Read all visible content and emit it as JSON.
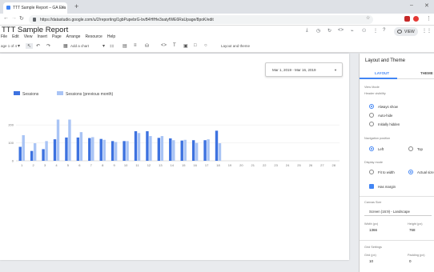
{
  "browser": {
    "tab_title": "TTT Sample Report – GA Exa",
    "url": "https://datastudio.google.com/u/2/reporting/1gbPupebrG-bvB4HfHe3satyfWE6RaUpage/8poK/edit"
  },
  "report": {
    "title": "TTT Sample Report",
    "menu": [
      "File",
      "Edit",
      "View",
      "Insert",
      "Page",
      "Arrange",
      "Resource",
      "Help"
    ],
    "page_indicator": "age 1 of 4",
    "add_chart": "Add a chart",
    "layout_theme": "Layout and theme",
    "view_label": "VIEW"
  },
  "date_range": "Mar 1, 2019 - Mar 16, 2019",
  "chart_data": {
    "type": "bar",
    "categories": [
      "1",
      "2",
      "3",
      "4",
      "5",
      "6",
      "7",
      "8",
      "9",
      "10",
      "11",
      "12",
      "13",
      "14",
      "15",
      "16",
      "17",
      "18",
      "19",
      "20",
      "21",
      "22",
      "23",
      "24",
      "25",
      "26",
      "27",
      "28"
    ],
    "series": [
      {
        "name": "Sessions",
        "color": "#3d72e0",
        "values": [
          78,
          55,
          65,
          120,
          130,
          130,
          127,
          122,
          110,
          110,
          165,
          165,
          128,
          125,
          113,
          115,
          115,
          168,
          null,
          null,
          null,
          null,
          null,
          null,
          null,
          null,
          null,
          null
        ]
      },
      {
        "name": "Sessions (previous month)",
        "color": "#a9c4f5",
        "values": [
          143,
          98,
          110,
          230,
          230,
          160,
          132,
          117,
          105,
          110,
          155,
          138,
          138,
          115,
          117,
          100,
          120,
          98,
          null,
          null,
          null,
          null,
          null,
          null,
          null,
          null,
          null,
          null
        ]
      }
    ],
    "y_ticks": [
      "200",
      "100",
      "0"
    ],
    "ylim": [
      0,
      250
    ],
    "legend_position": "top-left"
  },
  "panel": {
    "title": "Layout and Theme",
    "tabs": [
      "LAYOUT",
      "THEME"
    ],
    "view_mode_label": "View Mode",
    "header_visibility_label": "Header visibility",
    "header_options": [
      "Always show",
      "Auto-hide",
      "Initially hidden"
    ],
    "navigation_label": "Navigation position",
    "nav_options": [
      "Left",
      "Top"
    ],
    "display_mode_label": "Display mode",
    "display_options": [
      "Fit to width",
      "Actual size"
    ],
    "has_margin": "Has margin",
    "canvas_size_label": "Canvas Size",
    "canvas_size_value": "Screen (16:9) - Landscape",
    "width_label": "Width (px)",
    "width_value": "1366",
    "height_label": "Height (px)",
    "height_value": "768",
    "grid_label": "Grid Settings",
    "grid_size_label": "Grid (px)",
    "grid_size_value": "10",
    "padding_label": "Padding (px)",
    "padding_value": "0"
  }
}
